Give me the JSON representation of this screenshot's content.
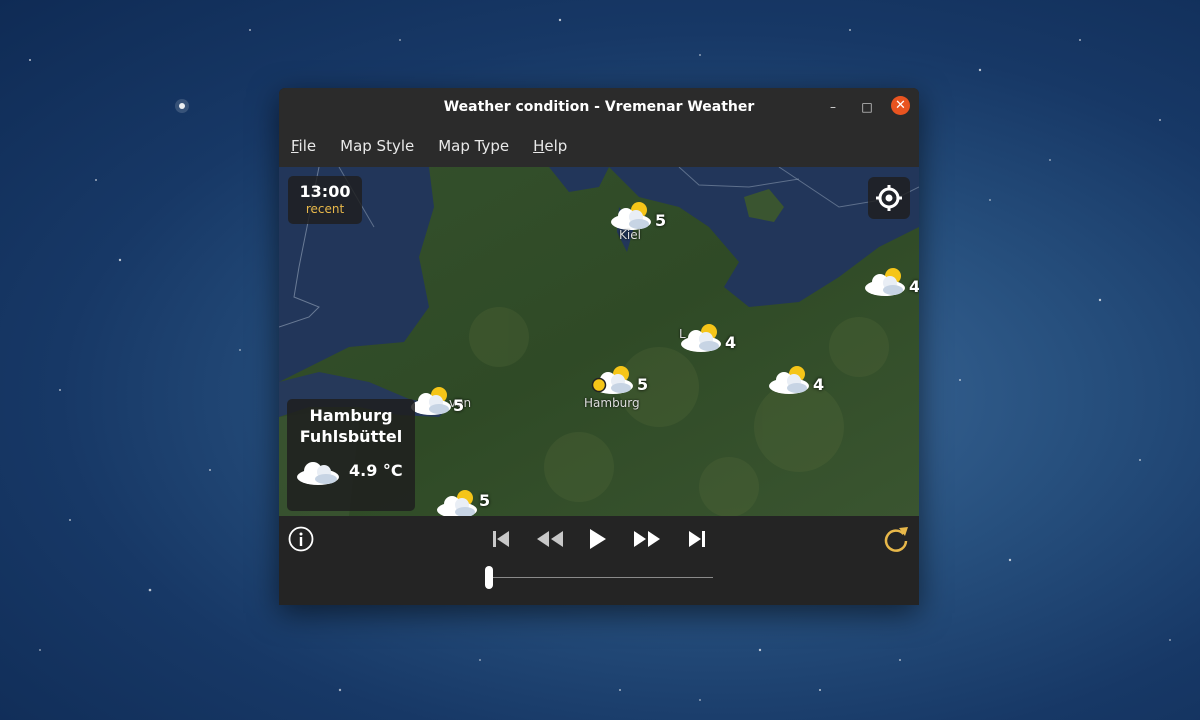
{
  "window": {
    "title": "Weather condition - Vremenar Weather",
    "controls": {
      "minimize": "–",
      "maximize": "□",
      "close": "✕"
    }
  },
  "menu": [
    {
      "label": "File",
      "mnemonic": "F",
      "rest": "ile"
    },
    {
      "label": "Map Style",
      "mnemonic": "",
      "rest": "Map Style"
    },
    {
      "label": "Map Type",
      "mnemonic": "",
      "rest": "Map Type"
    },
    {
      "label": "Help",
      "mnemonic": "H",
      "rest": "elp"
    }
  ],
  "map": {
    "time": "13:00",
    "time_status": "recent",
    "locate_icon": "crosshair-icon",
    "markers": [
      {
        "city": "Kiel",
        "temp": "5",
        "icon": "partly-cloudy-icon"
      },
      {
        "city": "",
        "temp": "4",
        "icon": "partly-cloudy-icon"
      },
      {
        "city": "L",
        "temp": "4",
        "icon": "partly-cloudy-icon"
      },
      {
        "city": "Hamburg",
        "temp": "5",
        "icon": "partly-cloudy-icon"
      },
      {
        "city": "",
        "temp": "4",
        "icon": "partly-cloudy-icon"
      },
      {
        "city": "ven",
        "temp": "5",
        "icon": "partly-cloudy-icon"
      },
      {
        "city": "",
        "temp": "5",
        "icon": "partly-cloudy-icon"
      }
    ],
    "selected_station": {
      "name_line1": "Hamburg",
      "name_line2": "Fuhlsbüttel",
      "reading": "4.9 °C",
      "icon": "cloudy-icon"
    }
  },
  "playback": {
    "info_icon": "info-icon",
    "buttons": [
      "skip-first-icon",
      "rewind-icon",
      "play-icon",
      "fast-forward-icon",
      "skip-last-icon"
    ],
    "refresh_icon": "refresh-icon",
    "slider_position": 0.0
  },
  "colors": {
    "accent": "#e8b84a",
    "close": "#e95420",
    "window_bg": "#222222"
  }
}
